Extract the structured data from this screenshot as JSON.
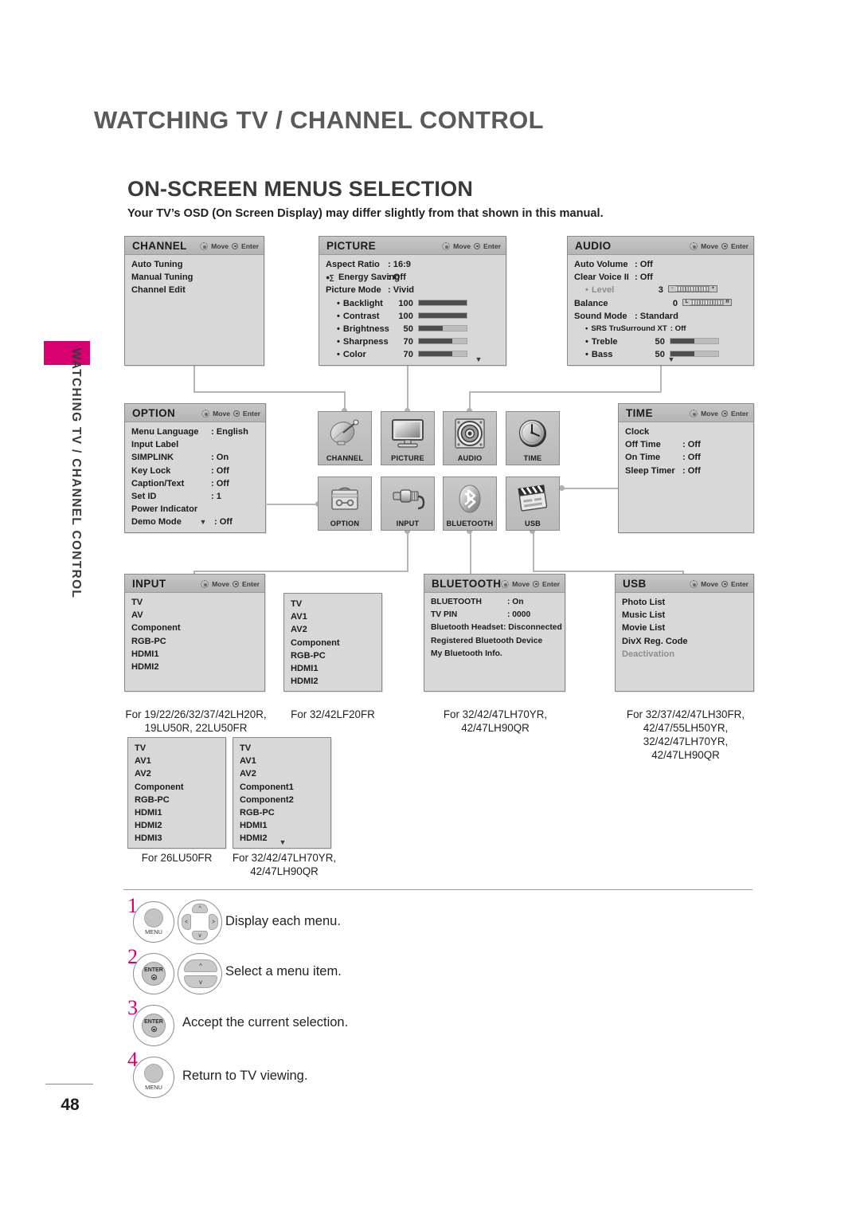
{
  "header": {
    "chapter": "WATCHING TV / CHANNEL CONTROL",
    "section_title": "ON-SCREEN MENUS SELECTION",
    "section_subtitle": "Your TV’s OSD (On Screen Display) may differ slightly from that shown in this manual.",
    "side_tab_text": "WATCHING TV / CHANNEL CONTROL",
    "page_number": "48"
  },
  "hint": {
    "move": "Move",
    "enter": "Enter"
  },
  "accent_color": "#d6006e",
  "panels": {
    "channel": {
      "title": "CHANNEL",
      "rows": [
        {
          "label": "Auto Tuning",
          "value": ""
        },
        {
          "label": "Manual Tuning",
          "value": ""
        },
        {
          "label": "Channel Edit",
          "value": ""
        }
      ]
    },
    "picture": {
      "title": "PICTURE",
      "rows": [
        {
          "label": "Aspect Ratio",
          "value": ": 16:9"
        },
        {
          "label": "Energy Saving",
          "value": ": Off",
          "icon": "eco-icon"
        },
        {
          "label": "Picture Mode",
          "value": ": Vivid"
        }
      ],
      "sliders": [
        {
          "label": "Backlight",
          "value": "100",
          "percent": 100
        },
        {
          "label": "Contrast",
          "value": "100",
          "percent": 100
        },
        {
          "label": "Brightness",
          "value": "50",
          "percent": 50
        },
        {
          "label": "Sharpness",
          "value": "70",
          "percent": 70
        },
        {
          "label": "Color",
          "value": "70",
          "percent": 70
        }
      ],
      "more": "▼"
    },
    "audio": {
      "title": "AUDIO",
      "rows": [
        {
          "label": "Auto Volume",
          "value": ": Off"
        },
        {
          "label": "Clear Voice II",
          "value": ": Off"
        }
      ],
      "level": {
        "label": "Level",
        "value": "3"
      },
      "balance": {
        "label": "Balance",
        "value": "0"
      },
      "sound_mode": {
        "label": "Sound Mode",
        "value": ": Standard"
      },
      "srs": {
        "label": "SRS TruSurround XT",
        "value": ": Off"
      },
      "sliders": [
        {
          "label": "Treble",
          "value": "50",
          "percent": 50
        },
        {
          "label": "Bass",
          "value": "50",
          "percent": 50
        }
      ],
      "more": "▼"
    },
    "option": {
      "title": "OPTION",
      "rows": [
        {
          "label": "Menu Language",
          "value": ": English"
        },
        {
          "label": "Input Label",
          "value": ""
        },
        {
          "label": "SIMPLINK",
          "value": ": On"
        },
        {
          "label": "Key Lock",
          "value": ": Off"
        },
        {
          "label": "Caption/Text",
          "value": ": Off"
        },
        {
          "label": "Set ID",
          "value": ": 1"
        },
        {
          "label": "Power Indicator",
          "value": ""
        },
        {
          "label": "Demo Mode",
          "value": ": Off"
        }
      ],
      "more": "▼"
    },
    "time": {
      "title": "TIME",
      "rows": [
        {
          "label": "Clock",
          "value": ""
        },
        {
          "label": "Off Time",
          "value": ": Off"
        },
        {
          "label": "On Time",
          "value": ": Off"
        },
        {
          "label": "Sleep Timer",
          "value": ": Off"
        }
      ]
    },
    "input": {
      "title": "INPUT",
      "rows": [
        {
          "label": "TV",
          "value": ""
        },
        {
          "label": "AV",
          "value": ""
        },
        {
          "label": "Component",
          "value": ""
        },
        {
          "label": "RGB-PC",
          "value": ""
        },
        {
          "label": "HDMI1",
          "value": ""
        },
        {
          "label": "HDMI2",
          "value": ""
        }
      ],
      "caption": "For 19/22/26/32/37/42LH20R,\n19LU50R, 22LU50FR"
    },
    "bluetooth": {
      "title": "BLUETOOTH",
      "rows": [
        {
          "label": "BLUETOOTH",
          "value": ": On"
        },
        {
          "label": "TV PIN",
          "value": ": 0000"
        },
        {
          "label": "Bluetooth Headset",
          "value": ": Disconnected"
        },
        {
          "label": "Registered Bluetooth Device",
          "value": ""
        },
        {
          "label": "My Bluetooth Info.",
          "value": ""
        }
      ],
      "caption": "For 32/42/47LH70YR,\n42/47LH90QR"
    },
    "usb": {
      "title": "USB",
      "rows": [
        {
          "label": "Photo List",
          "value": ""
        },
        {
          "label": "Music List",
          "value": ""
        },
        {
          "label": "Movie List",
          "value": ""
        },
        {
          "label": "DivX Reg. Code",
          "value": ""
        },
        {
          "label": "Deactivation",
          "value": "",
          "dim": true
        }
      ],
      "caption": "For 32/37/42/47LH30FR,\n42/47/55LH50YR,\n32/42/47LH70YR,\n42/47LH90QR"
    }
  },
  "input_variants": [
    {
      "rows": [
        "TV",
        "AV1",
        "AV2",
        "Component",
        "RGB-PC",
        "HDMI1",
        "HDMI2"
      ],
      "caption": "For 32/42LF20FR",
      "more": ""
    },
    {
      "rows": [
        "TV",
        "AV1",
        "AV2",
        "Component",
        "RGB-PC",
        "HDMI1",
        "HDMI2",
        "HDMI3"
      ],
      "caption": "For 26LU50FR",
      "more": ""
    },
    {
      "rows": [
        "TV",
        "AV1",
        "AV2",
        "Component1",
        "Component2",
        "RGB-PC",
        "HDMI1",
        "HDMI2"
      ],
      "caption": "For 32/42/47LH70YR,\n42/47LH90QR",
      "more": "▼"
    }
  ],
  "tiles": [
    {
      "name": "CHANNEL",
      "icon": "satellite-dish-icon"
    },
    {
      "name": "PICTURE",
      "icon": "monitor-icon"
    },
    {
      "name": "AUDIO",
      "icon": "speaker-icon"
    },
    {
      "name": "TIME",
      "icon": "clock-icon"
    },
    {
      "name": "OPTION",
      "icon": "toolbox-icon"
    },
    {
      "name": "INPUT",
      "icon": "rca-plug-icon"
    },
    {
      "name": "BLUETOOTH",
      "icon": "bluetooth-icon"
    },
    {
      "name": "USB",
      "icon": "clapperboard-icon"
    }
  ],
  "steps": [
    {
      "num": "1",
      "text": "Display each menu.",
      "buttons": [
        "MENU",
        "dpad"
      ]
    },
    {
      "num": "2",
      "text": "Select a menu item.",
      "buttons": [
        "ENTER",
        "updown"
      ]
    },
    {
      "num": "3",
      "text": "Accept the current selection.",
      "buttons": [
        "ENTER"
      ]
    },
    {
      "num": "4",
      "text": "Return to TV viewing.",
      "buttons": [
        "MENU"
      ]
    }
  ],
  "button_labels": {
    "menu": "MENU",
    "enter": "ENTER"
  }
}
